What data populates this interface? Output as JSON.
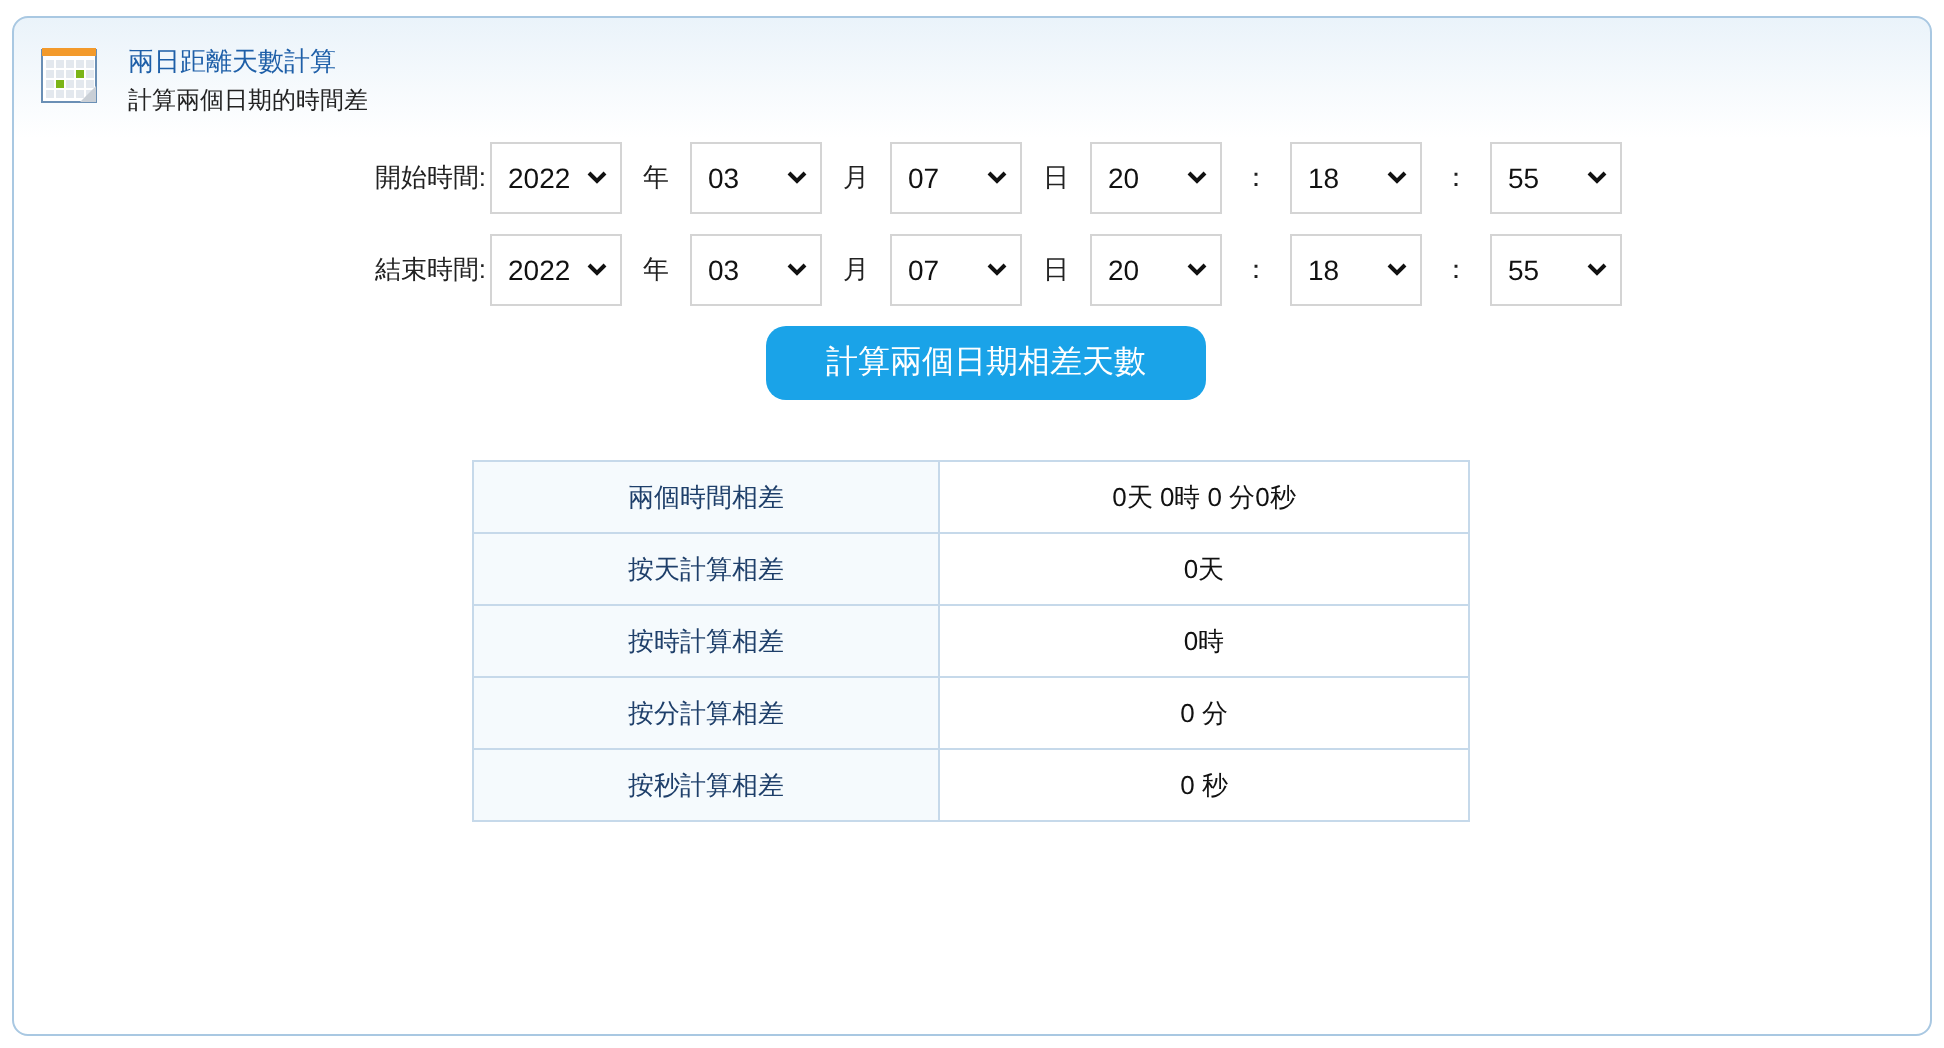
{
  "header": {
    "title": "兩日距離天數計算",
    "subtitle": "計算兩個日期的時間差"
  },
  "time_rows": [
    {
      "label": "開始時間:",
      "fields": [
        {
          "value": "2022",
          "unit": "年"
        },
        {
          "value": "03",
          "unit": "月"
        },
        {
          "value": "07",
          "unit": "日"
        },
        {
          "value": "20",
          "unit": "："
        },
        {
          "value": "18",
          "unit": "："
        },
        {
          "value": "55"
        }
      ]
    },
    {
      "label": "結束時間:",
      "fields": [
        {
          "value": "2022",
          "unit": "年"
        },
        {
          "value": "03",
          "unit": "月"
        },
        {
          "value": "07",
          "unit": "日"
        },
        {
          "value": "20",
          "unit": "："
        },
        {
          "value": "18",
          "unit": "："
        },
        {
          "value": "55"
        }
      ]
    }
  ],
  "calculate_button": "計算兩個日期相差天數",
  "results": [
    {
      "label": "兩個時間相差",
      "value": "0天 0時 0 分0秒"
    },
    {
      "label": "按天計算相差",
      "value": "0天"
    },
    {
      "label": "按時計算相差",
      "value": "0時"
    },
    {
      "label": "按分計算相差",
      "value": "0 分"
    },
    {
      "label": "按秒計算相差",
      "value": "0 秒"
    }
  ]
}
